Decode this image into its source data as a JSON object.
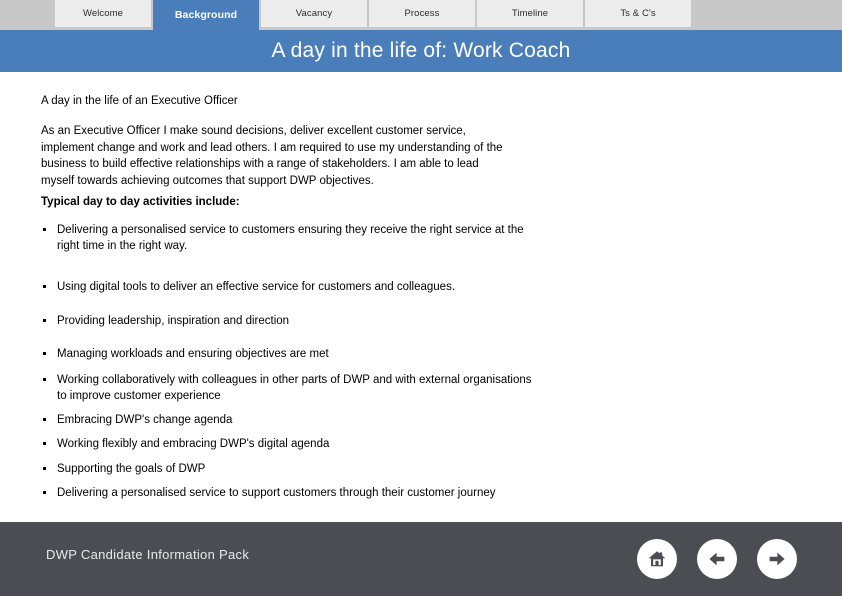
{
  "tabs": [
    {
      "label": "Welcome",
      "active": false,
      "width": 98
    },
    {
      "label": "Background",
      "active": true,
      "width": 108
    },
    {
      "label": "Vacancy",
      "active": false,
      "width": 108
    },
    {
      "label": "Process",
      "active": false,
      "width": 108
    },
    {
      "label": "Timeline",
      "active": false,
      "width": 108
    },
    {
      "label": "Ts & C's",
      "active": false,
      "width": 108
    }
  ],
  "header": {
    "title": "A day in the life of: Work Coach",
    "band_color": "#4a7ebb"
  },
  "main": {
    "lead_title": "A day in the life of an Executive Officer",
    "intro": "As an Executive Officer I make sound decisions, deliver excellent customer service, implement change and work and lead others. I am required to use my understanding of the business to build effective relationships with a range of stakeholders.  I am able to lead myself towards achieving outcomes that support DWP objectives.",
    "section_heading": "Typical day to day activities include:",
    "bullets": [
      {
        "text": "Delivering a personalised service to customers ensuring they receive the right service at the right time in the right way.",
        "gap_after": 24
      },
      {
        "text": "Using digital tools to deliver an effective service for customers and colleagues.",
        "gap_after": 18
      },
      {
        "text": "Providing leadership, inspiration and direction",
        "gap_after": 16
      },
      {
        "text": "Managing workloads and ensuring objectives are met",
        "gap_after": 10
      },
      {
        "text": "Working collaboratively with colleagues in other parts of DWP and with external organisations to improve customer experience",
        "gap_after": 7
      },
      {
        "text": "Embracing DWP's change agenda",
        "gap_after": 8
      },
      {
        "text": "Working flexibly and embracing DWP's digital agenda",
        "gap_after": 8
      },
      {
        "text": "Supporting the goals of DWP",
        "gap_after": 8
      },
      {
        "text": "Delivering a personalised service to support customers through their customer journey",
        "gap_after": 0
      }
    ]
  },
  "footer": {
    "text": "DWP Candidate Information Pack",
    "background_color": "#4b4d52",
    "nav": [
      {
        "name": "home-icon",
        "label": "Home"
      },
      {
        "name": "arrow-left-icon",
        "label": "Previous"
      },
      {
        "name": "arrow-right-icon",
        "label": "Next"
      }
    ]
  }
}
